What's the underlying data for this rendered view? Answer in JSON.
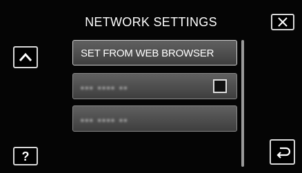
{
  "header": {
    "title": "NETWORK SETTINGS"
  },
  "menu": {
    "items": [
      {
        "label": "SET FROM WEB BROWSER"
      },
      {
        "label": "▪▪▪ ▪▪▪▪ ▪▪",
        "checked": false
      },
      {
        "label": "▪▪▪ ▪▪▪▪ ▪▪"
      }
    ]
  },
  "controls": {
    "help_label": "?"
  },
  "icons": {
    "close": "close-icon",
    "up": "chevron-up-icon",
    "back": "return-arrow-icon"
  },
  "colors": {
    "background": "#050505",
    "button_border": "#d9d9d9",
    "row_fill": "#505050",
    "text": "#ffffff"
  }
}
